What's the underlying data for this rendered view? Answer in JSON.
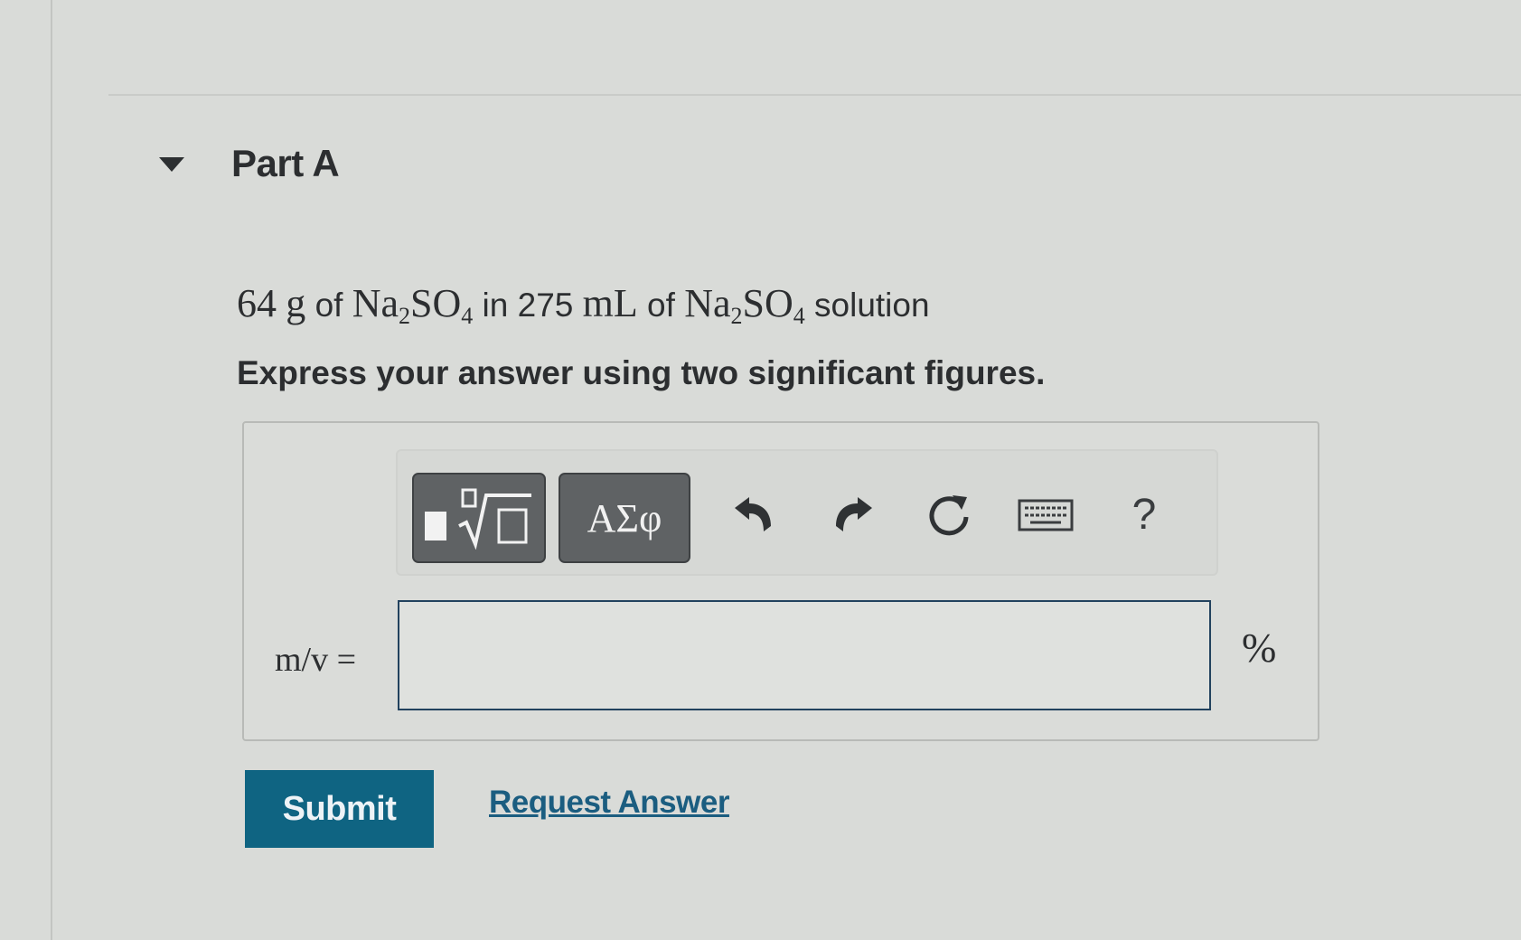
{
  "part": {
    "title": "Part A"
  },
  "question": {
    "mass": "64",
    "mass_unit": "g",
    "of_1": "of",
    "compound_1": {
      "el1": "Na",
      "sub1": "2",
      "el2": "SO",
      "sub2": "4"
    },
    "in_text": "in",
    "volume": "275",
    "volume_unit": "mL",
    "of_2": "of",
    "compound_2": {
      "el1": "Na",
      "sub1": "2",
      "el2": "SO",
      "sub2": "4"
    },
    "tail": "solution"
  },
  "instruction": "Express your answer using two significant figures.",
  "toolbar": {
    "templates_icon": "templates-radical-icon",
    "greek_label": "ΑΣφ",
    "undo_icon": "undo-icon",
    "redo_icon": "redo-icon",
    "reset_icon": "reset-icon",
    "keyboard_icon": "keyboard-icon",
    "help_label": "?"
  },
  "answer": {
    "label": "m/v =",
    "value": "",
    "unit": "%"
  },
  "actions": {
    "submit_label": "Submit",
    "request_answer_label": "Request Answer"
  },
  "colors": {
    "submit_bg": "#0f6482",
    "link": "#1b5d80",
    "toolbar_button": "#5f6264",
    "input_border": "#22425e"
  }
}
